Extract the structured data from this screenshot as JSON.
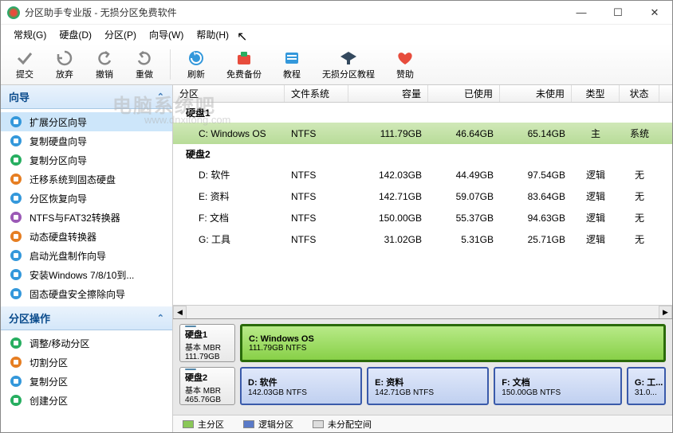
{
  "window": {
    "title": "分区助手专业版 - 无损分区免费软件"
  },
  "menu": {
    "general": "常规(G)",
    "disk": "硬盘(D)",
    "partition": "分区(P)",
    "wizard": "向导(W)",
    "help": "帮助(H)"
  },
  "toolbar": {
    "commit": "提交",
    "discard": "放弃",
    "undo": "撤销",
    "redo": "重做",
    "refresh": "刷新",
    "backup": "免费备份",
    "tutorial": "教程",
    "lossless_tutorial": "无损分区教程",
    "donate": "赞助"
  },
  "sidebar": {
    "wizard_title": "向导",
    "wizards": [
      {
        "label": "扩展分区向导",
        "icon": "expand"
      },
      {
        "label": "复制硬盘向导",
        "icon": "copy-disk"
      },
      {
        "label": "复制分区向导",
        "icon": "copy-part"
      },
      {
        "label": "迁移系统到固态硬盘",
        "icon": "migrate"
      },
      {
        "label": "分区恢复向导",
        "icon": "recover"
      },
      {
        "label": "NTFS与FAT32转换器",
        "icon": "convert"
      },
      {
        "label": "动态硬盘转换器",
        "icon": "dynamic"
      },
      {
        "label": "启动光盘制作向导",
        "icon": "bootcd"
      },
      {
        "label": "安装Windows 7/8/10到...",
        "icon": "install"
      },
      {
        "label": "固态硬盘安全擦除向导",
        "icon": "erase"
      }
    ],
    "ops_title": "分区操作",
    "ops": [
      {
        "label": "调整/移动分区",
        "icon": "resize"
      },
      {
        "label": "切割分区",
        "icon": "split"
      },
      {
        "label": "复制分区",
        "icon": "copy"
      },
      {
        "label": "创建分区",
        "icon": "create"
      }
    ]
  },
  "table": {
    "headers": {
      "partition": "分区",
      "filesystem": "文件系统",
      "capacity": "容量",
      "used": "已使用",
      "free": "未使用",
      "type": "类型",
      "status": "状态"
    },
    "disk1_label": "硬盘1",
    "disk1_rows": [
      {
        "part": "C: Windows OS",
        "fs": "NTFS",
        "cap": "111.79GB",
        "used": "46.64GB",
        "free": "65.14GB",
        "type": "主",
        "status": "系统"
      }
    ],
    "disk2_label": "硬盘2",
    "disk2_rows": [
      {
        "part": "D: 软件",
        "fs": "NTFS",
        "cap": "142.03GB",
        "used": "44.49GB",
        "free": "97.54GB",
        "type": "逻辑",
        "status": "无"
      },
      {
        "part": "E: 资料",
        "fs": "NTFS",
        "cap": "142.71GB",
        "used": "59.07GB",
        "free": "83.64GB",
        "type": "逻辑",
        "status": "无"
      },
      {
        "part": "F: 文档",
        "fs": "NTFS",
        "cap": "150.00GB",
        "used": "55.37GB",
        "free": "94.63GB",
        "type": "逻辑",
        "status": "无"
      },
      {
        "part": "G: 工具",
        "fs": "NTFS",
        "cap": "31.02GB",
        "used": "5.31GB",
        "free": "25.71GB",
        "type": "逻辑",
        "status": "无"
      }
    ]
  },
  "diskmap": {
    "disk1": {
      "name": "硬盘1",
      "scheme": "基本 MBR",
      "size": "111.79GB",
      "parts": [
        {
          "name": "C: Windows OS",
          "size": "111.79GB NTFS"
        }
      ]
    },
    "disk2": {
      "name": "硬盘2",
      "scheme": "基本 MBR",
      "size": "465.76GB",
      "parts": [
        {
          "name": "D: 软件",
          "size": "142.03GB NTFS"
        },
        {
          "name": "E: 资料",
          "size": "142.71GB NTFS"
        },
        {
          "name": "F: 文档",
          "size": "150.00GB NTFS"
        },
        {
          "name": "G: 工...",
          "size": "31.0..."
        }
      ]
    }
  },
  "legend": {
    "primary": "主分区",
    "logical": "逻辑分区",
    "unallocated": "未分配空间"
  },
  "watermark": {
    "main": "电脑系统吧",
    "sub": "www.dnxitong.com"
  }
}
